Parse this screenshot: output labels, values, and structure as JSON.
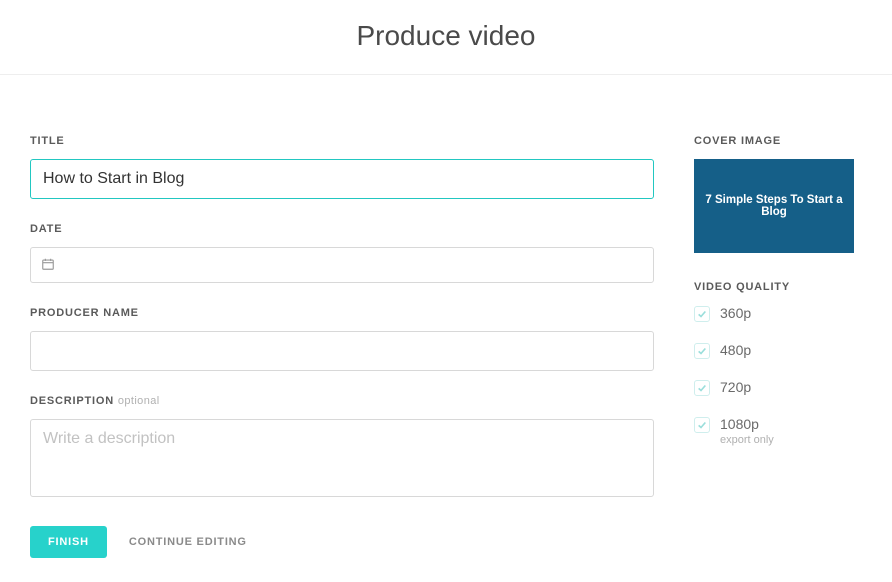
{
  "page": {
    "title": "Produce video"
  },
  "form": {
    "title_label": "TITLE",
    "title_value": "How to Start in Blog",
    "date_label": "DATE",
    "date_value": "",
    "producer_label": "PRODUCER NAME",
    "producer_value": "",
    "description_label": "DESCRIPTION",
    "description_optional": "optional",
    "description_placeholder": "Write a description",
    "description_value": ""
  },
  "buttons": {
    "finish": "FINISH",
    "continue_editing": "CONTINUE EDITING"
  },
  "cover": {
    "label": "COVER IMAGE",
    "thumb_text": "7 Simple Steps To Start a Blog"
  },
  "quality": {
    "label": "VIDEO QUALITY",
    "options": [
      {
        "label": "360p",
        "sub": ""
      },
      {
        "label": "480p",
        "sub": ""
      },
      {
        "label": "720p",
        "sub": ""
      },
      {
        "label": "1080p",
        "sub": "export only"
      }
    ]
  }
}
